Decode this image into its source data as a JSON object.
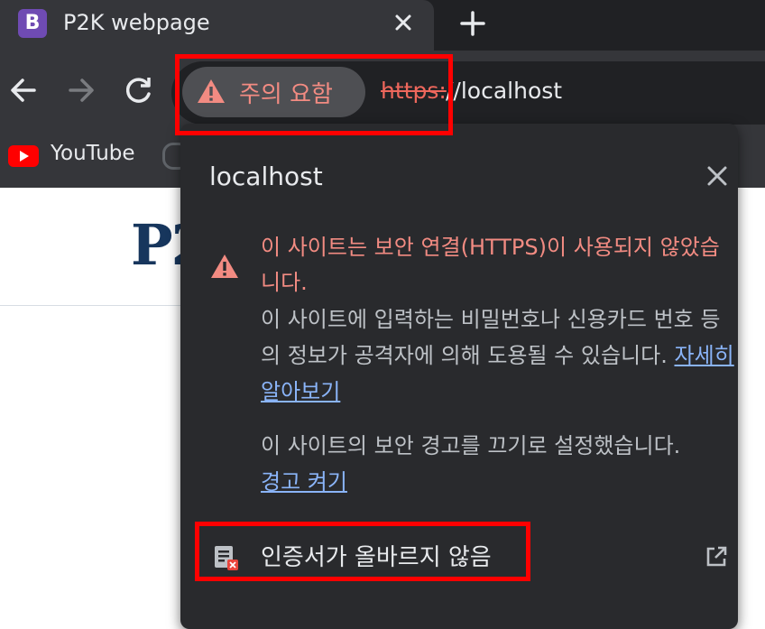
{
  "tab": {
    "favicon_letter": "B",
    "title": "P2K webpage",
    "favicon_color": "#6f4bb3"
  },
  "toolbar": {
    "security_chip_label": "주의 요함",
    "url_scheme": "https:",
    "url_rest": "//localhost"
  },
  "bookmarks": [
    {
      "label": "YouTube",
      "icon": "youtube-icon"
    }
  ],
  "page": {
    "logo_text": "P2K"
  },
  "popup": {
    "title": "localhost",
    "warning_title": "이 사이트는 보안 연결(HTTPS)이 사용되지 않았습니다.",
    "warning_body": "이 사이트에 입력하는 비밀번호나 신용카드 번호 등의 정보가 공격자에 의해 도용될 수 있습니다.",
    "learn_more": "자세히 알아보기",
    "warnings_off_text": "이 사이트의 보안 경고를 끄기로 설정했습니다.",
    "turn_on_warnings": "경고 켜기",
    "certificate_label": "인증서가 올바르지 않음"
  },
  "colors": {
    "warning_red": "#f28b82",
    "link_blue": "#8ab4f8",
    "highlight": "#ff0000"
  }
}
